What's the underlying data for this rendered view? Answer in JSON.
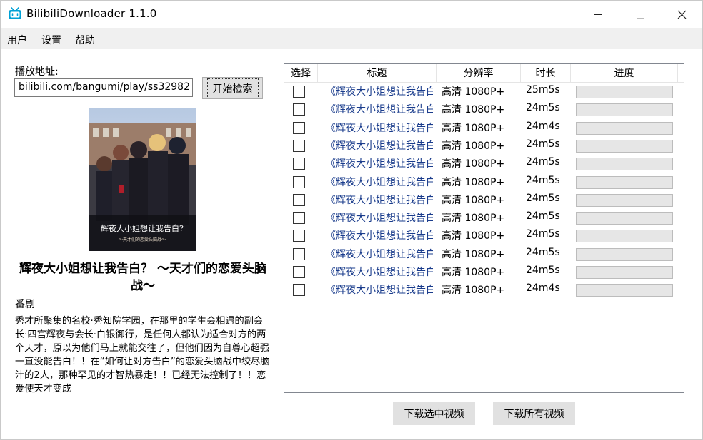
{
  "window": {
    "title": "BilibiliDownloader 1.1.0",
    "icon": "bilibili-tv-icon",
    "accent_color": "#00a1d6"
  },
  "menu": [
    "用户",
    "设置",
    "帮助"
  ],
  "search": {
    "label": "播放地址:",
    "value": "bilibili.com/bangumi/play/ss32982",
    "button_label": "开始检索"
  },
  "anime": {
    "title": "辉夜大小姐想让我告白？ ～天才们的恋爱头脑战～",
    "type": "番剧",
    "description": "秀才所聚集的名校·秀知院学园，在那里的学生会相遇的副会长·四宫辉夜与会长·白银御行，是任何人都认为适合对方的两个天才，原以为他们马上就能交往了，但他们因为自尊心超强一直没能告白！！在“如何让对方告白”的恋爱头脑战中绞尽脑汁的2人，那种罕见的才智热暴走！！已经无法控制了！！恋爱使天才变成",
    "poster_text": "辉夜大小姐想让我告白?"
  },
  "table": {
    "headers": [
      "选择",
      "标题",
      "分辨率",
      "时长",
      "进度"
    ],
    "rows": [
      {
        "title": "《辉夜大小姐想让我告白",
        "resolution": "高清 1080P+",
        "duration": "25m5s",
        "progress": 0
      },
      {
        "title": "《辉夜大小姐想让我告白",
        "resolution": "高清 1080P+",
        "duration": "24m5s",
        "progress": 0
      },
      {
        "title": "《辉夜大小姐想让我告白",
        "resolution": "高清 1080P+",
        "duration": "24m4s",
        "progress": 0
      },
      {
        "title": "《辉夜大小姐想让我告白",
        "resolution": "高清 1080P+",
        "duration": "24m5s",
        "progress": 0
      },
      {
        "title": "《辉夜大小姐想让我告白",
        "resolution": "高清 1080P+",
        "duration": "24m5s",
        "progress": 0
      },
      {
        "title": "《辉夜大小姐想让我告白",
        "resolution": "高清 1080P+",
        "duration": "24m5s",
        "progress": 0
      },
      {
        "title": "《辉夜大小姐想让我告白",
        "resolution": "高清 1080P+",
        "duration": "24m5s",
        "progress": 0
      },
      {
        "title": "《辉夜大小姐想让我告白",
        "resolution": "高清 1080P+",
        "duration": "24m5s",
        "progress": 0
      },
      {
        "title": "《辉夜大小姐想让我告白",
        "resolution": "高清 1080P+",
        "duration": "24m5s",
        "progress": 0
      },
      {
        "title": "《辉夜大小姐想让我告白",
        "resolution": "高清 1080P+",
        "duration": "24m5s",
        "progress": 0
      },
      {
        "title": "《辉夜大小姐想让我告白",
        "resolution": "高清 1080P+",
        "duration": "24m5s",
        "progress": 0
      },
      {
        "title": "《辉夜大小姐想让我告白",
        "resolution": "高清 1080P+",
        "duration": "24m4s",
        "progress": 0
      }
    ]
  },
  "actions": {
    "download_selected": "下载选中视频",
    "download_all": "下载所有视频"
  }
}
